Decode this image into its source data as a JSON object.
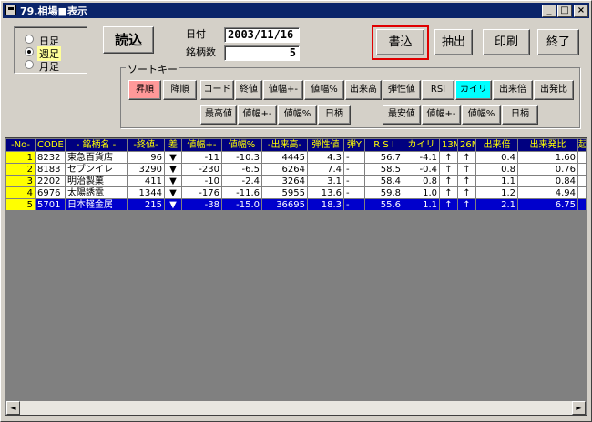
{
  "window": {
    "title": "79.相場■表示",
    "btn_min": "_",
    "btn_max": "□",
    "btn_close": "×"
  },
  "period": {
    "options": [
      {
        "label": "日足",
        "selected": false
      },
      {
        "label": "週足",
        "selected": true
      },
      {
        "label": "月足",
        "selected": false
      }
    ]
  },
  "toolbar": {
    "load": "読込",
    "write": "書込",
    "extract": "抽出",
    "print": "印刷",
    "exit": "終了"
  },
  "info": {
    "date_label": "日付",
    "date_value": "2003/11/16",
    "count_label": "銘柄数",
    "count_value": "5"
  },
  "sort": {
    "label": "ソートキー",
    "asc": "昇順",
    "desc": "降順",
    "row1": [
      "コード",
      "終値",
      "値幅+-",
      "値幅%",
      "出来高",
      "弾性値",
      "RSI",
      "カイリ",
      "出来倍",
      "出発比"
    ],
    "row1_active": "カイリ",
    "row2a": [
      "最高値",
      "値幅+-",
      "値幅%",
      "日柄"
    ],
    "row2b": [
      "最安値",
      "値幅+-",
      "値幅%",
      "日柄"
    ]
  },
  "table": {
    "headers": [
      "-No-",
      "CODE",
      "- 銘柄名 -",
      "-終値-",
      "差",
      "値幅+-",
      "値幅%",
      "-出来高-",
      "弾性値",
      "弾Y",
      "R S I",
      "カイリ",
      "13M",
      "26M",
      "出来倍",
      "出来発比",
      "起"
    ],
    "rows": [
      [
        "1",
        "8232",
        "東急百貨店",
        "96",
        "▼",
        "-11",
        "-10.3",
        "4445",
        "4.3",
        "-",
        "56.7",
        "-4.1",
        "↑",
        "↑",
        "0.4",
        "1.60"
      ],
      [
        "2",
        "8183",
        "セブンイレ",
        "3290",
        "▼",
        "-230",
        "-6.5",
        "6264",
        "7.4",
        "-",
        "58.5",
        "-0.4",
        "↑",
        "↑",
        "0.8",
        "0.76"
      ],
      [
        "3",
        "2202",
        "明治製菓",
        "411",
        "▼",
        "-10",
        "-2.4",
        "3264",
        "3.1",
        "-",
        "58.4",
        "0.8",
        "↑",
        "↑",
        "1.1",
        "0.84"
      ],
      [
        "4",
        "6976",
        "太陽誘電",
        "1344",
        "▼",
        "-176",
        "-11.6",
        "5955",
        "13.6",
        "-",
        "59.8",
        "1.0",
        "↑",
        "↑",
        "1.2",
        "4.94"
      ],
      [
        "5",
        "5701",
        "日本軽金属",
        "215",
        "▼",
        "-38",
        "-15.0",
        "36695",
        "18.3",
        "-",
        "55.6",
        "1.1",
        "↑",
        "↑",
        "2.1",
        "6.75"
      ]
    ],
    "selected_row": 4
  },
  "scroll": {
    "left": "◄",
    "right": "►"
  },
  "colors": {
    "titlebar": "#0a246a",
    "header_bg": "#000080",
    "header_fg": "#ffff00",
    "selection": "#0000cc",
    "highlight_box": "#e00000",
    "active_sort": "#00ffff"
  }
}
